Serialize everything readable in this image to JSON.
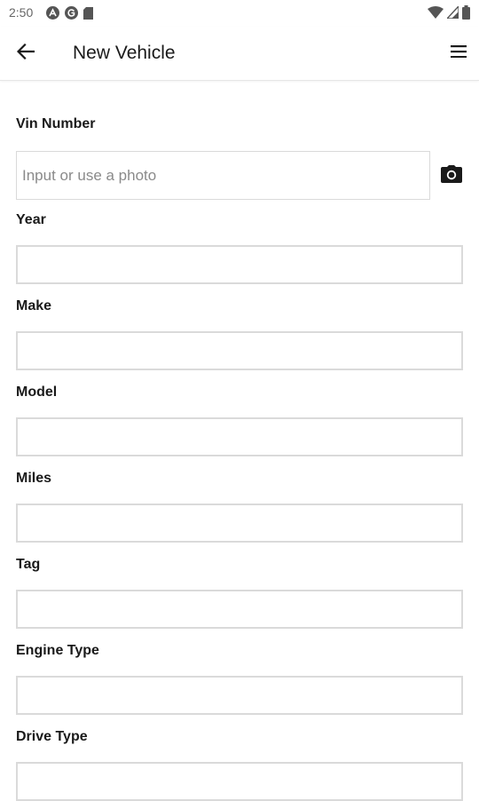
{
  "status_bar": {
    "time": "2:50",
    "left_icons": [
      "notification-a-icon",
      "notification-g-icon",
      "sd-card-icon"
    ],
    "right_icons": [
      "wifi-icon",
      "signal-icon",
      "battery-icon"
    ]
  },
  "app_bar": {
    "title": "New Vehicle",
    "back_icon": "arrow-left-icon",
    "menu_icon": "hamburger-menu-icon"
  },
  "form": {
    "vin": {
      "label": "Vin Number",
      "placeholder": "Input or use a photo",
      "value": "",
      "action_icon": "camera-icon"
    },
    "year": {
      "label": "Year",
      "value": ""
    },
    "make": {
      "label": "Make",
      "value": ""
    },
    "model": {
      "label": "Model",
      "value": ""
    },
    "miles": {
      "label": "Miles",
      "value": ""
    },
    "tag": {
      "label": "Tag",
      "value": ""
    },
    "engine_type": {
      "label": "Engine Type",
      "value": ""
    },
    "drive_type": {
      "label": "Drive Type",
      "value": ""
    }
  },
  "colors": {
    "border": "#dadada",
    "text": "#1a1a1a",
    "placeholder": "#8a8a8a"
  }
}
